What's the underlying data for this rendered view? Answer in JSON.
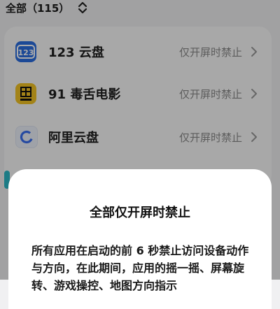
{
  "header": {
    "title": "全部（115）"
  },
  "apps": [
    {
      "name": "123 云盘",
      "status": "仅开屏时禁止",
      "icon": "123pan-icon",
      "color": "#2a6de0"
    },
    {
      "name": "91 毒舌电影",
      "status": "仅开屏时禁止",
      "icon": "dushe-movie-icon",
      "color": "#f3c425"
    },
    {
      "name": "阿里云盘",
      "status": "仅开屏时禁止",
      "icon": "aliyun-drive-icon",
      "color": "#3a6ff0"
    }
  ],
  "dialog": {
    "title": "全部仅开屏时禁止",
    "body": "所有应用在启动的前 6 秒禁止访问设备动作与方向，在此期间，应用的摇一摇、屏幕旋转、游戏操控、地图方向指示"
  }
}
